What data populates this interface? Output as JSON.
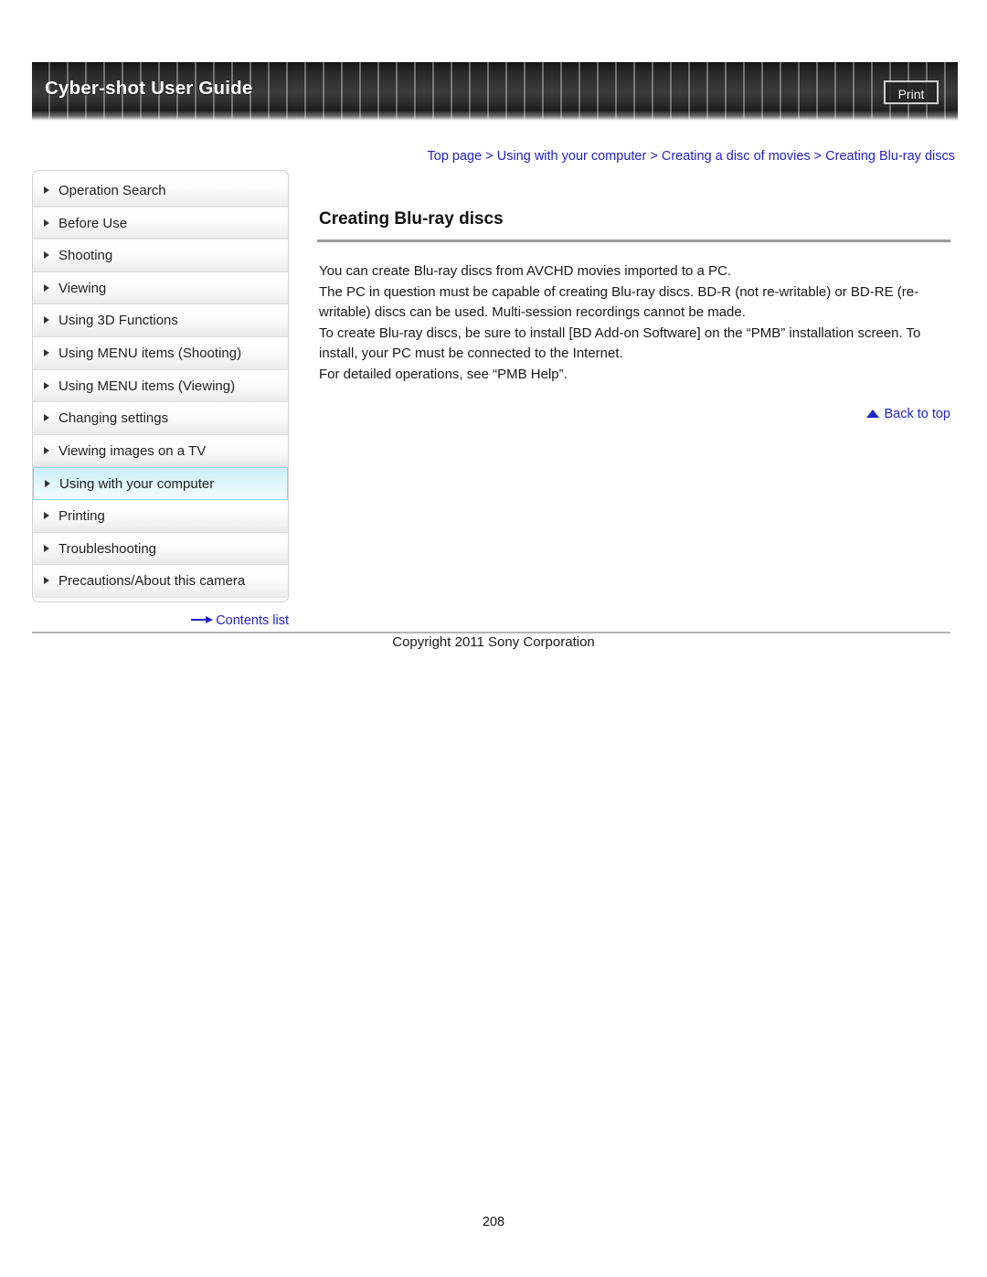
{
  "header": {
    "title": "Cyber-shot User Guide",
    "print_label": "Print"
  },
  "breadcrumb": {
    "separator": " > ",
    "items": [
      "Top page",
      "Using with your computer",
      "Creating a disc of movies",
      "Creating Blu-ray discs"
    ]
  },
  "sidebar": {
    "items": [
      {
        "label": "Operation Search",
        "active": false
      },
      {
        "label": "Before Use",
        "active": false
      },
      {
        "label": "Shooting",
        "active": false
      },
      {
        "label": "Viewing",
        "active": false
      },
      {
        "label": "Using 3D Functions",
        "active": false
      },
      {
        "label": "Using MENU items (Shooting)",
        "active": false
      },
      {
        "label": "Using MENU items (Viewing)",
        "active": false
      },
      {
        "label": "Changing settings",
        "active": false
      },
      {
        "label": "Viewing images on a TV",
        "active": false
      },
      {
        "label": "Using with your computer",
        "active": true
      },
      {
        "label": "Printing",
        "active": false
      },
      {
        "label": "Troubleshooting",
        "active": false
      },
      {
        "label": "Precautions/About this camera",
        "active": false
      }
    ],
    "contents_list_label": "Contents list"
  },
  "main": {
    "title": "Creating Blu-ray discs",
    "paragraphs": [
      "You can create Blu-ray discs from AVCHD movies imported to a PC.",
      "The PC in question must be capable of creating Blu-ray discs. BD-R (not re-writable) or BD-RE (re-writable) discs can be used. Multi-session recordings cannot be made.",
      "To create Blu-ray discs, be sure to install [BD Add-on Software] on the “PMB” installation screen. To install, your PC must be connected to the Internet.",
      "For detailed operations, see “PMB Help”."
    ],
    "back_to_top_label": "Back to top"
  },
  "footer": {
    "copyright": "Copyright 2011 Sony Corporation",
    "page_number": "208"
  },
  "colors": {
    "link": "#2222cc",
    "header_bg": "#2c2c2c",
    "active_nav": "#cdeef8",
    "rule": "#9a9a9a"
  }
}
